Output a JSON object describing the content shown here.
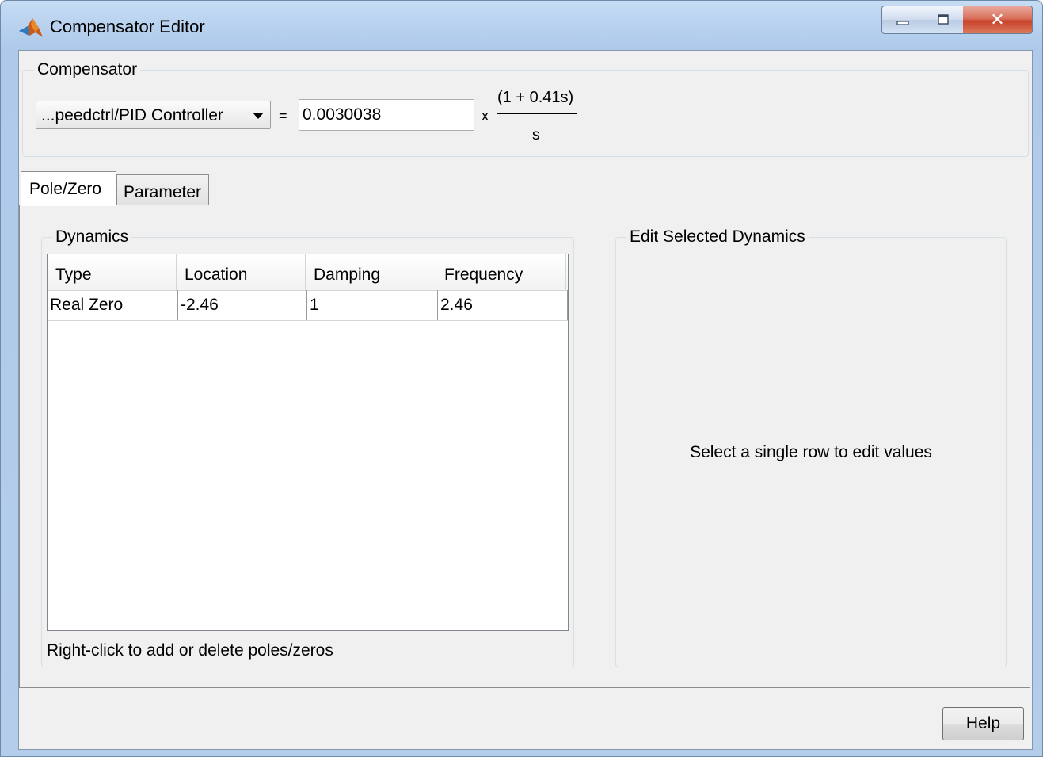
{
  "window": {
    "title": "Compensator Editor",
    "icon": "matlab-logo-icon",
    "controls": {
      "minimize": "minimize-icon",
      "maximize": "maximize-icon",
      "close": "✕"
    }
  },
  "compensator": {
    "group_label": "Compensator",
    "selected": "...peedctrl/PID Controller",
    "equals": "=",
    "gain": "0.0030038",
    "times": "x",
    "numerator": "(1 + 0.41s)",
    "denominator": "s"
  },
  "tabs": [
    {
      "label": "Pole/Zero",
      "active": true
    },
    {
      "label": "Parameter",
      "active": false
    }
  ],
  "dynamics": {
    "group_label": "Dynamics",
    "columns": [
      "Type",
      "Location",
      "Damping",
      "Frequency"
    ],
    "rows": [
      [
        "Real Zero",
        "-2.46",
        "1",
        "2.46"
      ]
    ],
    "hint": "Right-click to add or delete poles/zeros"
  },
  "edit_selected": {
    "group_label": "Edit Selected Dynamics",
    "placeholder": "Select a single row to edit values"
  },
  "footer": {
    "help_label": "Help"
  },
  "colors": {
    "title_bar": "#b9d2ef",
    "client_bg": "#f0f0f0",
    "close_button": "#c7432b"
  }
}
